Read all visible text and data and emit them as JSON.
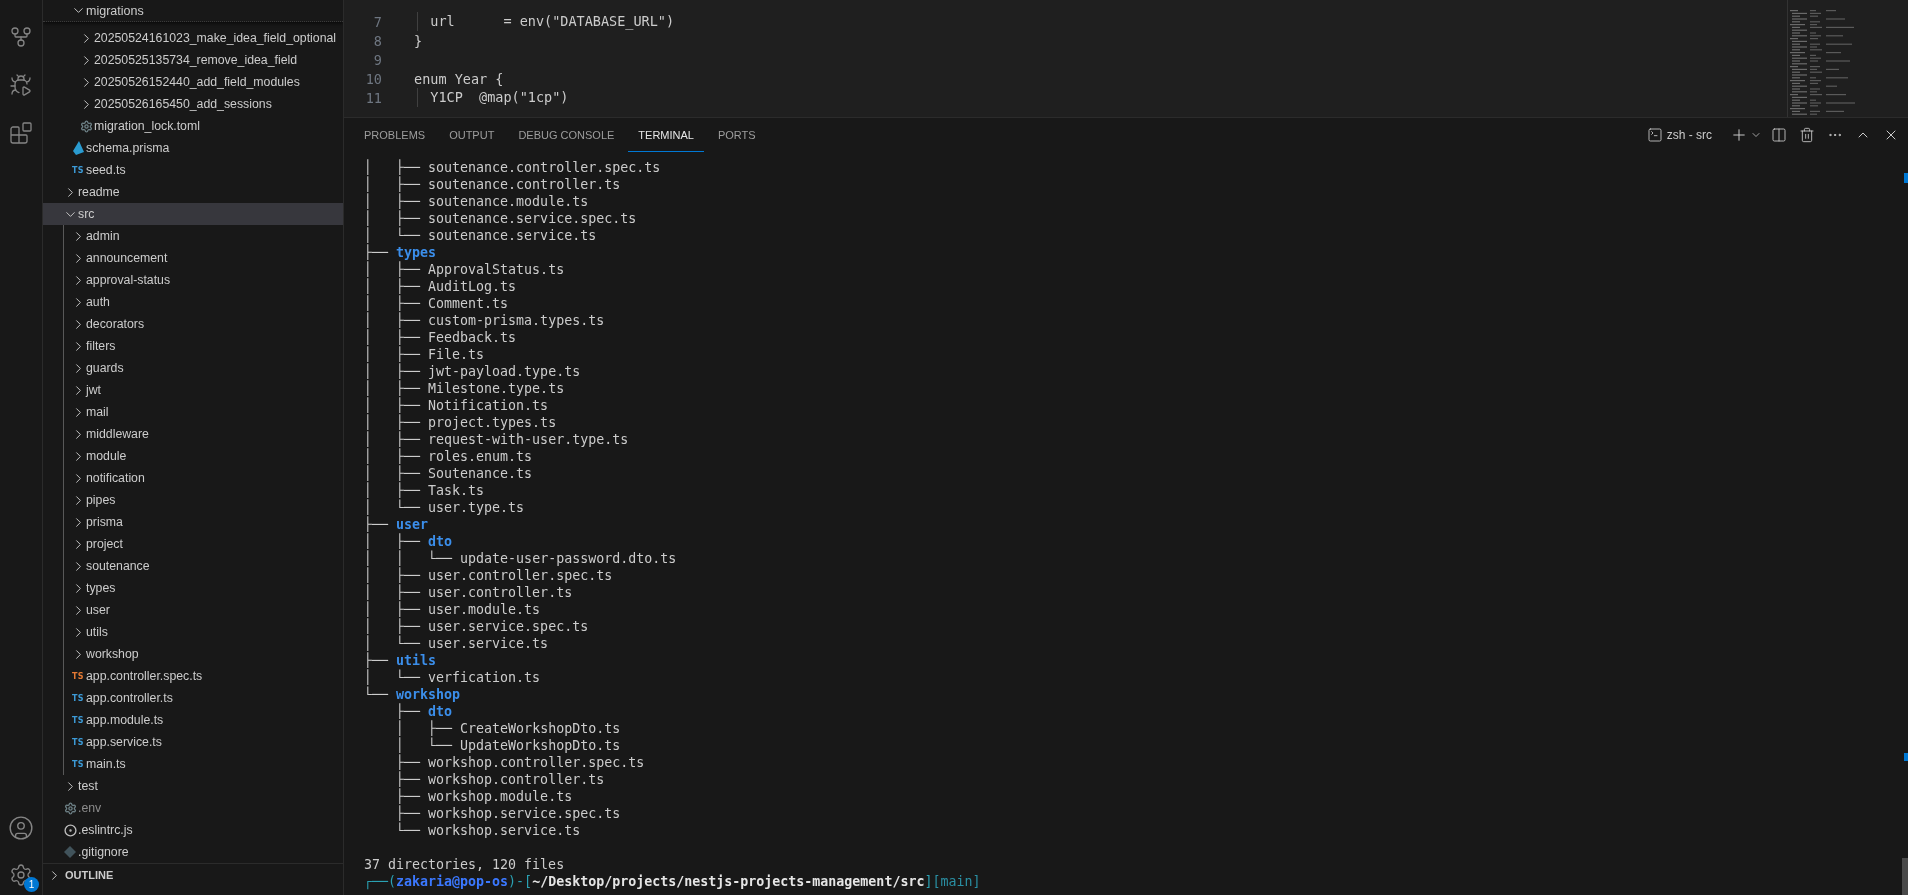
{
  "activity_bar": {
    "settings_badge": "1"
  },
  "sidebar": {
    "sticky_folder": {
      "label": "migrations",
      "expanded": true
    },
    "migrations_children": [
      {
        "label": "20250524161023_make_idea_field_optional",
        "kind": "folder",
        "expanded": false,
        "selected": false,
        "dimmed": false
      },
      {
        "label": "20250525135734_remove_idea_field",
        "kind": "folder",
        "expanded": false,
        "selected": false,
        "dimmed": false
      },
      {
        "label": "20250526152440_add_field_modules",
        "kind": "folder",
        "expanded": false,
        "selected": false,
        "dimmed": false
      },
      {
        "label": "20250526165450_add_sessions",
        "kind": "folder",
        "expanded": false,
        "selected": false,
        "dimmed": false
      },
      {
        "label": "migration_lock.toml",
        "kind": "gear-file",
        "selected": false,
        "dimmed": false
      }
    ],
    "prisma_children": [
      {
        "label": "schema.prisma",
        "kind": "prisma-file",
        "selected": false,
        "dimmed": false
      },
      {
        "label": "seed.ts",
        "kind": "ts-file",
        "icon_label": "TS",
        "selected": false,
        "dimmed": false
      }
    ],
    "root_items": [
      {
        "label": "readme",
        "kind": "folder",
        "expanded": false,
        "selected": false,
        "dimmed": false
      },
      {
        "label": "src",
        "kind": "folder",
        "expanded": true,
        "selected": true,
        "dimmed": false,
        "children": [
          {
            "label": "admin",
            "kind": "folder",
            "expanded": false,
            "selected": false,
            "dimmed": false
          },
          {
            "label": "announcement",
            "kind": "folder",
            "expanded": false,
            "selected": false,
            "dimmed": false
          },
          {
            "label": "approval-status",
            "kind": "folder",
            "expanded": false,
            "selected": false,
            "dimmed": false
          },
          {
            "label": "auth",
            "kind": "folder",
            "expanded": false,
            "selected": false,
            "dimmed": false
          },
          {
            "label": "decorators",
            "kind": "folder",
            "expanded": false,
            "selected": false,
            "dimmed": false
          },
          {
            "label": "filters",
            "kind": "folder",
            "expanded": false,
            "selected": false,
            "dimmed": false
          },
          {
            "label": "guards",
            "kind": "folder",
            "expanded": false,
            "selected": false,
            "dimmed": false
          },
          {
            "label": "jwt",
            "kind": "folder",
            "expanded": false,
            "selected": false,
            "dimmed": false
          },
          {
            "label": "mail",
            "kind": "folder",
            "expanded": false,
            "selected": false,
            "dimmed": false
          },
          {
            "label": "middleware",
            "kind": "folder",
            "expanded": false,
            "selected": false,
            "dimmed": false
          },
          {
            "label": "module",
            "kind": "folder",
            "expanded": false,
            "selected": false,
            "dimmed": false
          },
          {
            "label": "notification",
            "kind": "folder",
            "expanded": false,
            "selected": false,
            "dimmed": false
          },
          {
            "label": "pipes",
            "kind": "folder",
            "expanded": false,
            "selected": false,
            "dimmed": false
          },
          {
            "label": "prisma",
            "kind": "folder",
            "expanded": false,
            "selected": false,
            "dimmed": false
          },
          {
            "label": "project",
            "kind": "folder",
            "expanded": false,
            "selected": false,
            "dimmed": false
          },
          {
            "label": "soutenance",
            "kind": "folder",
            "expanded": false,
            "selected": false,
            "dimmed": false
          },
          {
            "label": "types",
            "kind": "folder",
            "expanded": false,
            "selected": false,
            "dimmed": false
          },
          {
            "label": "user",
            "kind": "folder",
            "expanded": false,
            "selected": false,
            "dimmed": false
          },
          {
            "label": "utils",
            "kind": "folder",
            "expanded": false,
            "selected": false,
            "dimmed": false
          },
          {
            "label": "workshop",
            "kind": "folder",
            "expanded": false,
            "selected": false,
            "dimmed": false
          },
          {
            "label": "app.controller.spec.ts",
            "kind": "ts-spec-file",
            "icon_label": "TS",
            "selected": false,
            "dimmed": false
          },
          {
            "label": "app.controller.ts",
            "kind": "ts-file",
            "icon_label": "TS",
            "selected": false,
            "dimmed": false
          },
          {
            "label": "app.module.ts",
            "kind": "ts-file",
            "icon_label": "TS",
            "selected": false,
            "dimmed": false
          },
          {
            "label": "app.service.ts",
            "kind": "ts-file",
            "icon_label": "TS",
            "selected": false,
            "dimmed": false
          },
          {
            "label": "main.ts",
            "kind": "ts-file",
            "icon_label": "TS",
            "selected": false,
            "dimmed": false
          }
        ]
      },
      {
        "label": "test",
        "kind": "folder",
        "expanded": false,
        "selected": false,
        "dimmed": false
      },
      {
        "label": ".env",
        "kind": "gear-file",
        "selected": false,
        "dimmed": true
      },
      {
        "label": ".eslintrc.js",
        "kind": "eslint-file",
        "selected": false,
        "dimmed": false
      },
      {
        "label": ".gitignore",
        "kind": "git-file",
        "selected": false,
        "dimmed": false
      }
    ],
    "sections": [
      {
        "label": "OUTLINE",
        "expanded": false
      }
    ]
  },
  "editor": {
    "lines": [
      {
        "number": "7",
        "code": "  url      = env(\"DATABASE_URL\")"
      },
      {
        "number": "8",
        "code": "}"
      },
      {
        "number": "9"
      },
      {
        "number": "10",
        "code": "enum Year {"
      },
      {
        "number": "11",
        "code": "  Y1CP  @map(\"1cp\")"
      }
    ]
  },
  "panel": {
    "tabs": [
      {
        "label": "PROBLEMS",
        "selected": false
      },
      {
        "label": "OUTPUT",
        "selected": false
      },
      {
        "label": "DEBUG CONSOLE",
        "selected": false
      },
      {
        "label": "TERMINAL",
        "selected": true
      },
      {
        "label": "PORTS",
        "selected": false
      }
    ],
    "terminal_name": "zsh - src",
    "terminal": {
      "lines": [
        {
          "prefix": "│   ├── ",
          "name": "soutenance.controller.spec.ts",
          "kind": "file"
        },
        {
          "prefix": "│   ├── ",
          "name": "soutenance.controller.ts",
          "kind": "file"
        },
        {
          "prefix": "│   ├── ",
          "name": "soutenance.module.ts",
          "kind": "file"
        },
        {
          "prefix": "│   ├── ",
          "name": "soutenance.service.spec.ts",
          "kind": "file"
        },
        {
          "prefix": "│   └── ",
          "name": "soutenance.service.ts",
          "kind": "file"
        },
        {
          "prefix": "├── ",
          "name": "types",
          "kind": "dir"
        },
        {
          "prefix": "│   ├── ",
          "name": "ApprovalStatus.ts",
          "kind": "file"
        },
        {
          "prefix": "│   ├── ",
          "name": "AuditLog.ts",
          "kind": "file"
        },
        {
          "prefix": "│   ├── ",
          "name": "Comment.ts",
          "kind": "file"
        },
        {
          "prefix": "│   ├── ",
          "name": "custom-prisma.types.ts",
          "kind": "file"
        },
        {
          "prefix": "│   ├── ",
          "name": "Feedback.ts",
          "kind": "file"
        },
        {
          "prefix": "│   ├── ",
          "name": "File.ts",
          "kind": "file"
        },
        {
          "prefix": "│   ├── ",
          "name": "jwt-payload.type.ts",
          "kind": "file"
        },
        {
          "prefix": "│   ├── ",
          "name": "Milestone.type.ts",
          "kind": "file"
        },
        {
          "prefix": "│   ├── ",
          "name": "Notification.ts",
          "kind": "file"
        },
        {
          "prefix": "│   ├── ",
          "name": "project.types.ts",
          "kind": "file"
        },
        {
          "prefix": "│   ├── ",
          "name": "request-with-user.type.ts",
          "kind": "file"
        },
        {
          "prefix": "│   ├── ",
          "name": "roles.enum.ts",
          "kind": "file"
        },
        {
          "prefix": "│   ├── ",
          "name": "Soutenance.ts",
          "kind": "file"
        },
        {
          "prefix": "│   ├── ",
          "name": "Task.ts",
          "kind": "file"
        },
        {
          "prefix": "│   └── ",
          "name": "user.type.ts",
          "kind": "file"
        },
        {
          "prefix": "├── ",
          "name": "user",
          "kind": "dir"
        },
        {
          "prefix": "│   ├── ",
          "name": "dto",
          "kind": "dir"
        },
        {
          "prefix": "│   │   └── ",
          "name": "update-user-password.dto.ts",
          "kind": "file"
        },
        {
          "prefix": "│   ├── ",
          "name": "user.controller.spec.ts",
          "kind": "file"
        },
        {
          "prefix": "│   ├── ",
          "name": "user.controller.ts",
          "kind": "file"
        },
        {
          "prefix": "│   ├── ",
          "name": "user.module.ts",
          "kind": "file"
        },
        {
          "prefix": "│   ├── ",
          "name": "user.service.spec.ts",
          "kind": "file"
        },
        {
          "prefix": "│   └── ",
          "name": "user.service.ts",
          "kind": "file"
        },
        {
          "prefix": "├── ",
          "name": "utils",
          "kind": "dir"
        },
        {
          "prefix": "│   └── ",
          "name": "verfication.ts",
          "kind": "file"
        },
        {
          "prefix": "└── ",
          "name": "workshop",
          "kind": "dir"
        },
        {
          "prefix": "    ├── ",
          "name": "dto",
          "kind": "dir"
        },
        {
          "prefix": "    │   ├── ",
          "name": "CreateWorkshopDto.ts",
          "kind": "file"
        },
        {
          "prefix": "    │   └── ",
          "name": "UpdateWorkshopDto.ts",
          "kind": "file"
        },
        {
          "prefix": "    ├── ",
          "name": "workshop.controller.spec.ts",
          "kind": "file"
        },
        {
          "prefix": "    ├── ",
          "name": "workshop.controller.ts",
          "kind": "file"
        },
        {
          "prefix": "    ├── ",
          "name": "workshop.module.ts",
          "kind": "file"
        },
        {
          "prefix": "    ├── ",
          "name": "workshop.service.spec.ts",
          "kind": "file"
        },
        {
          "prefix": "    └── ",
          "name": "workshop.service.ts",
          "kind": "file"
        }
      ],
      "summary": "37 directories, 120 files",
      "prompt": [
        {
          "text": "┌──(",
          "kind": "frame"
        },
        {
          "text": "zakaria@pop-os",
          "kind": "user"
        },
        {
          "text": ")-[",
          "kind": "frame"
        },
        {
          "text": "~/Desktop/projects/nestjs-projects-management/src",
          "kind": "path"
        },
        {
          "text": "]",
          "kind": "frame"
        },
        {
          "text": "[main]",
          "kind": "branch"
        }
      ]
    }
  }
}
